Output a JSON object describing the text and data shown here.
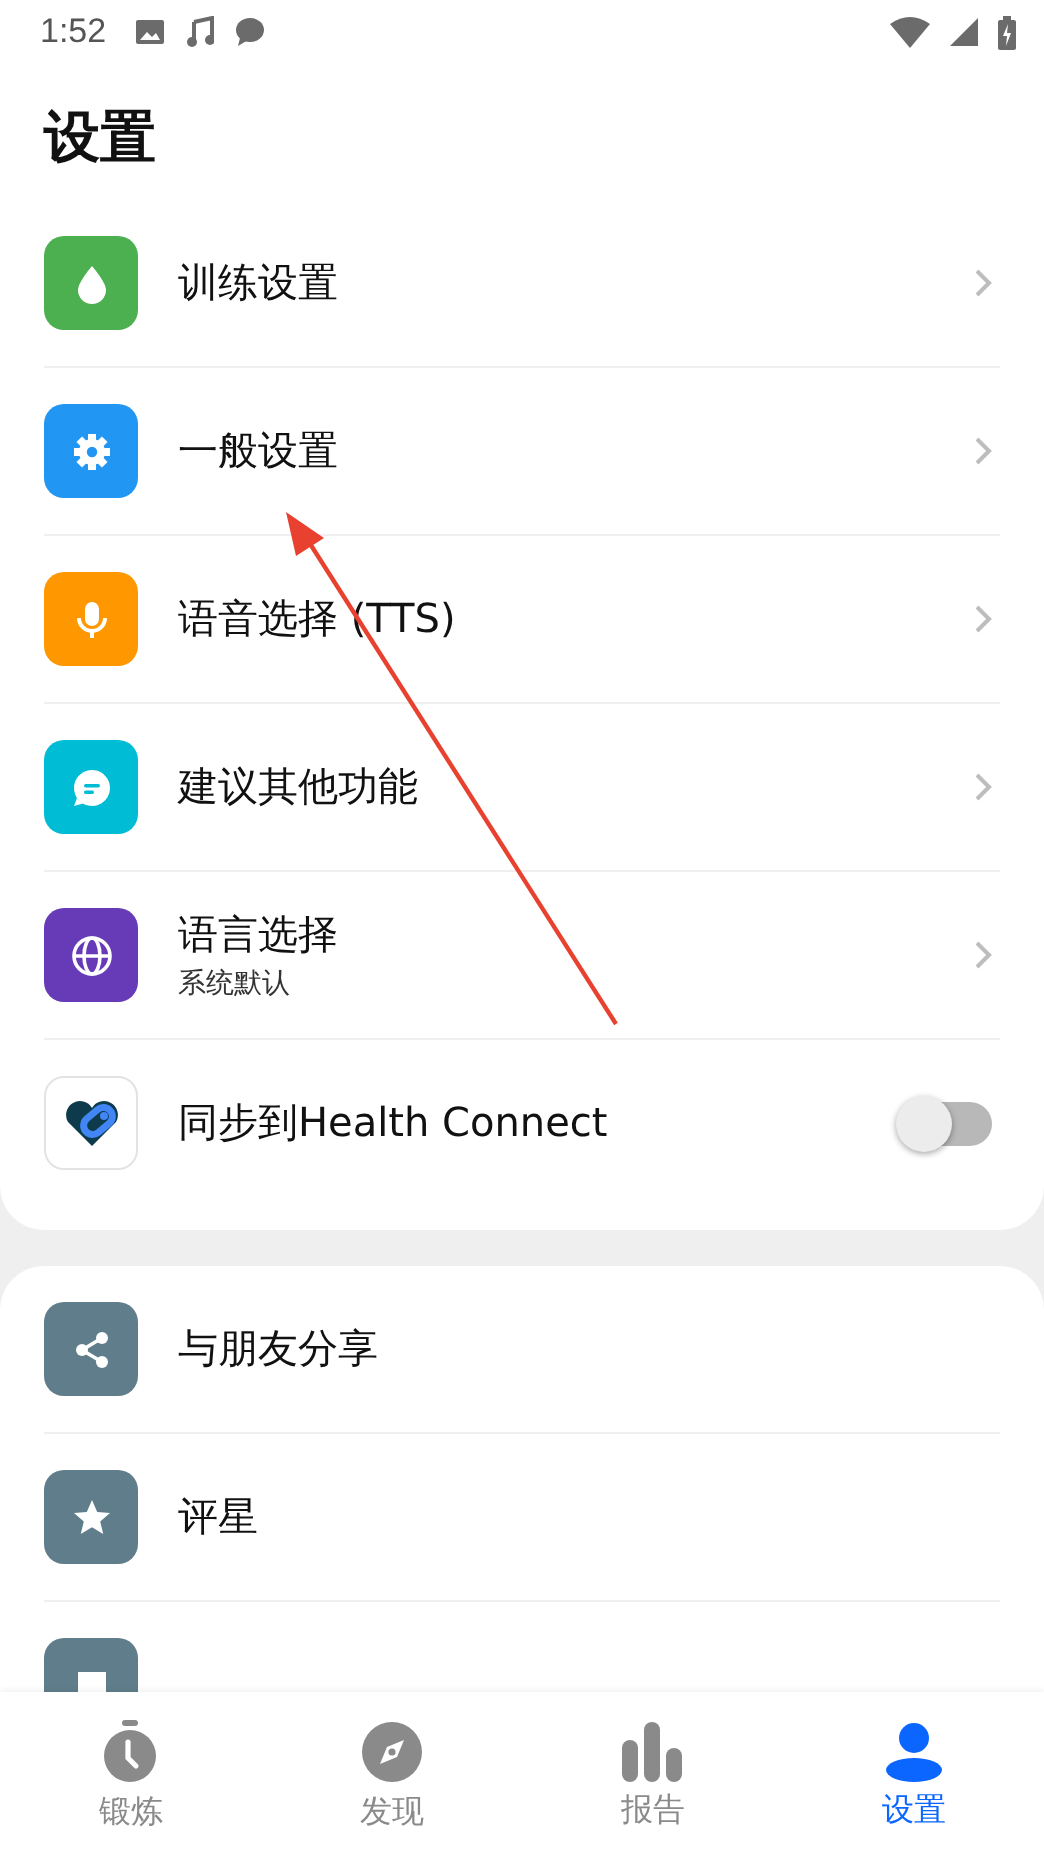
{
  "status_bar": {
    "time": "1:52"
  },
  "title": "设置",
  "settings": [
    {
      "kind": "drop",
      "color": "#4caf50",
      "label": "训练设置",
      "chevron": true
    },
    {
      "kind": "gear",
      "color": "#2196f3",
      "label": "一般设置",
      "chevron": true
    },
    {
      "kind": "mic",
      "color": "#ff9800",
      "label": "语音选择 (TTS)",
      "chevron": true
    },
    {
      "kind": "bubble",
      "color": "#00bcd4",
      "label": "建议其他功能",
      "chevron": true
    },
    {
      "kind": "globe",
      "color": "#673ab7",
      "label": "语言选择",
      "subtitle": "系统默认",
      "chevron": true
    },
    {
      "kind": "health",
      "color": "#ffffff",
      "label": "同步到Health Connect",
      "toggle": {
        "on": false
      }
    }
  ],
  "more": [
    {
      "kind": "share",
      "color": "#607d8b",
      "label": "与朋友分享"
    },
    {
      "kind": "star",
      "color": "#607d8b",
      "label": "评星"
    },
    {
      "kind": "feedback",
      "color": "#607d8b"
    }
  ],
  "tabs": [
    {
      "kind": "timer",
      "label": "锻炼",
      "selected": false
    },
    {
      "kind": "compass",
      "label": "发现",
      "selected": false
    },
    {
      "kind": "chart",
      "label": "报告",
      "selected": false
    },
    {
      "kind": "person",
      "label": "设置",
      "selected": true
    }
  ]
}
